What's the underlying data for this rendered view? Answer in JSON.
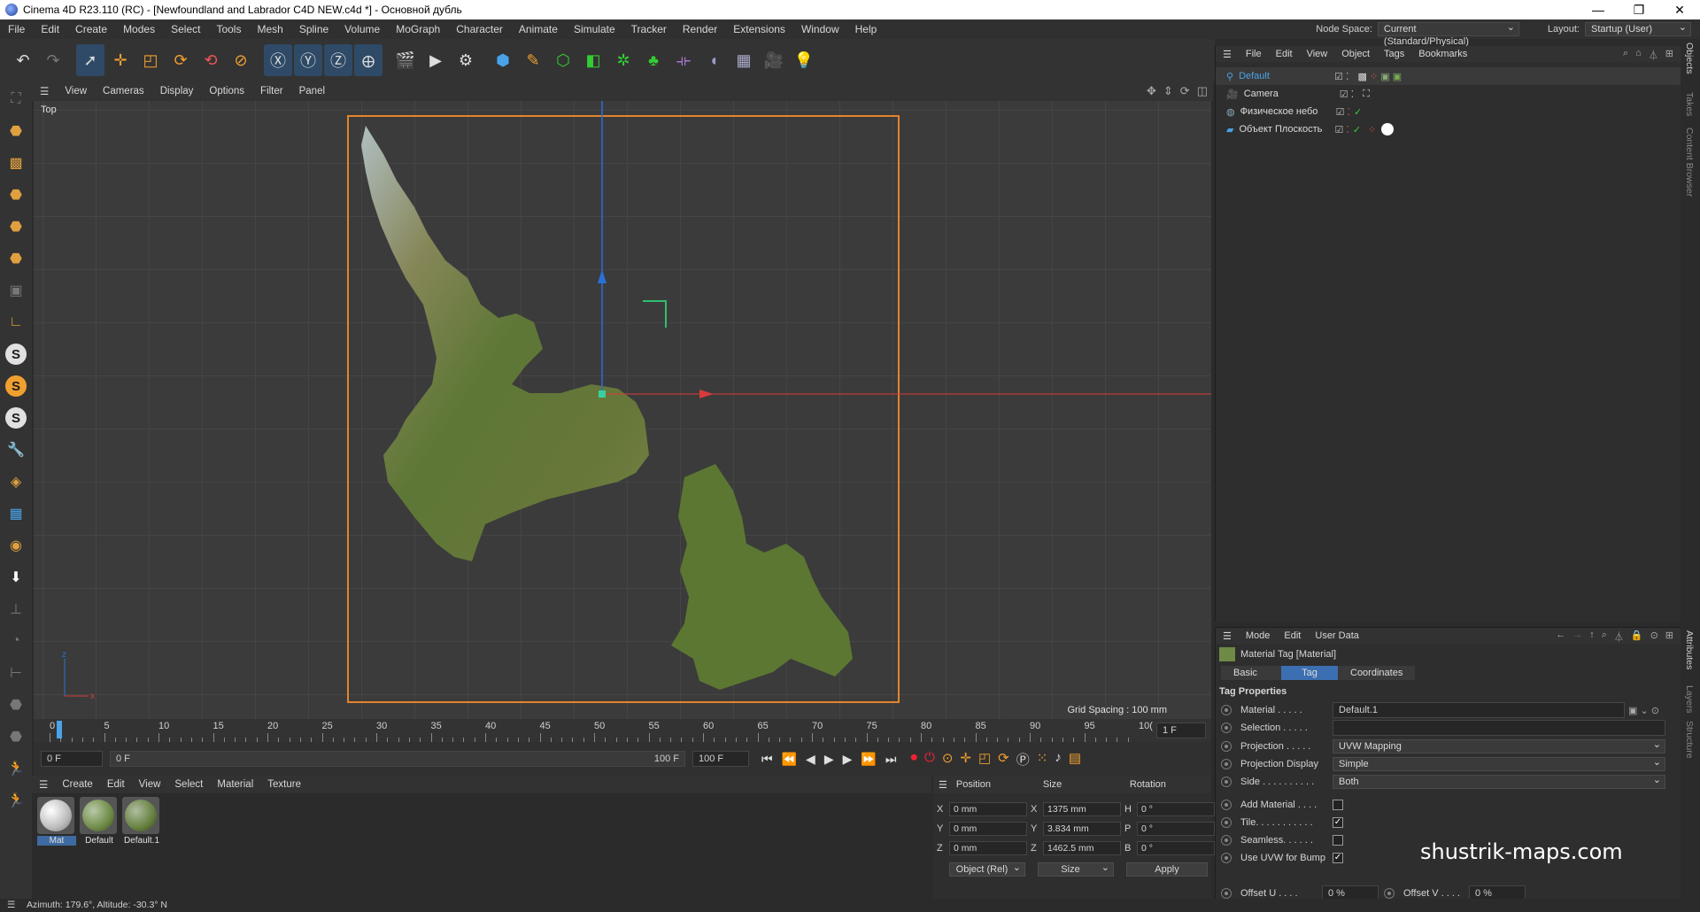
{
  "window": {
    "title": "Cinema 4D R23.110 (RC) - [Newfoundland and Labrador C4D NEW.c4d *] - Основной дубль",
    "minimize": "—",
    "restore": "❐",
    "close": "✕"
  },
  "menubar": {
    "items": [
      "File",
      "Edit",
      "Create",
      "Modes",
      "Select",
      "Tools",
      "Mesh",
      "Spline",
      "Volume",
      "MoGraph",
      "Character",
      "Animate",
      "Simulate",
      "Tracker",
      "Render",
      "Extensions",
      "Window",
      "Help"
    ],
    "node_space_label": "Node Space:",
    "node_space_value": "Current (Standard/Physical)",
    "layout_label": "Layout:",
    "layout_value": "Startup (User)"
  },
  "viewport": {
    "menu": [
      "View",
      "Cameras",
      "Display",
      "Options",
      "Filter",
      "Panel"
    ],
    "label": "Top",
    "grid_spacing": "Grid Spacing : 100 mm",
    "axis_z": "z",
    "axis_x": "x"
  },
  "timeline": {
    "ticks": [
      "0",
      "5",
      "10",
      "15",
      "20",
      "25",
      "30",
      "35",
      "40",
      "45",
      "50",
      "55",
      "60",
      "65",
      "70",
      "75",
      "80",
      "85",
      "90",
      "95",
      "10("
    ],
    "current_frame_box": "1 F",
    "start": "0 F",
    "range_start": "0 F",
    "range_end": "100 F",
    "end": "100 F"
  },
  "material_manager": {
    "menu": [
      "Create",
      "Edit",
      "View",
      "Select",
      "Material",
      "Texture"
    ],
    "materials": [
      {
        "name": "Mat",
        "selected": true
      },
      {
        "name": "Default",
        "selected": false
      },
      {
        "name": "Default.1",
        "selected": false
      }
    ]
  },
  "coordinates": {
    "headers": [
      "Position",
      "Size",
      "Rotation"
    ],
    "rows": [
      {
        "axis": "X",
        "pos": "0 mm",
        "size_axis": "X",
        "size": "1375 mm",
        "rot_axis": "H",
        "rot": "0 °"
      },
      {
        "axis": "Y",
        "pos": "0 mm",
        "size_axis": "Y",
        "size": "3.834 mm",
        "rot_axis": "P",
        "rot": "0 °"
      },
      {
        "axis": "Z",
        "pos": "0 mm",
        "size_axis": "Z",
        "size": "1462.5 mm",
        "rot_axis": "B",
        "rot": "0 °"
      }
    ],
    "mode": "Object (Rel)",
    "size_mode": "Size",
    "apply": "Apply"
  },
  "object_manager": {
    "menu": [
      "File",
      "Edit",
      "View",
      "Object",
      "Tags",
      "Bookmarks"
    ],
    "objects": [
      {
        "name": "Default",
        "selected": true
      },
      {
        "name": "Camera",
        "selected": false
      },
      {
        "name": "Физическое небо",
        "selected": false
      },
      {
        "name": "Объект Плоскость",
        "selected": false
      }
    ]
  },
  "attributes": {
    "menu": [
      "Mode",
      "Edit",
      "User Data"
    ],
    "header": "Material Tag [Material]",
    "tabs": [
      "Basic",
      "Tag",
      "Coordinates"
    ],
    "active_tab": "Tag",
    "section": "Tag Properties",
    "material_label": "Material . . . . .",
    "material_value": "Default.1",
    "selection_label": "Selection . . . . .",
    "projection_label": "Projection . . . . .",
    "projection_value": "UVW Mapping",
    "projection_display_label": "Projection Display",
    "projection_display_value": "Simple",
    "side_label": "Side . . . . . . . . . .",
    "side_value": "Both",
    "add_material_label": "Add Material . . . .",
    "tile_label": "Tile. . . . . . . . . . .",
    "seamless_label": "Seamless. . . . . .",
    "use_uvw_label": "Use UVW for Bump",
    "offset_u_label": "Offset U . . . .",
    "offset_u_value": "0 %",
    "offset_v_label": "Offset V . . . .",
    "offset_v_value": "0 %"
  },
  "side_tabs": [
    "Objects",
    "Takes",
    "Content Browser",
    "Attributes",
    "Layers",
    "Structure"
  ],
  "watermark": "shustrik-maps.com",
  "status": "Azimuth: 179.6°, Altitude: -30.3°  N",
  "colors": {
    "accent": "#3c6fb1",
    "frame": "#e3842d",
    "y_axis": "#2a6fd6",
    "x_axis": "#d83b3b"
  }
}
